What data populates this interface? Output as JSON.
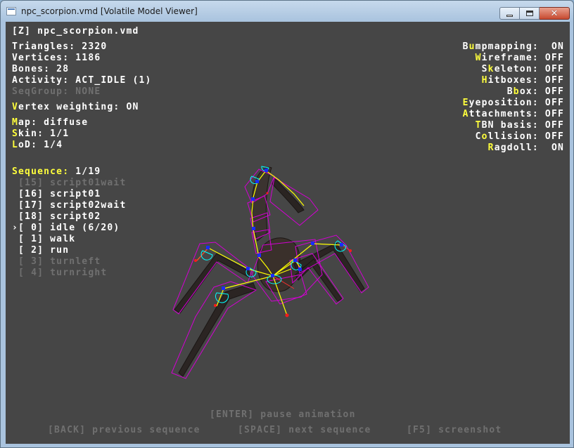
{
  "window": {
    "title": "npc_scorpion.vmd [Volatile Model Viewer]",
    "buttons": {
      "minimize": "minimize-icon",
      "maximize": "maximize-icon",
      "close": "close-icon"
    }
  },
  "hud": {
    "model_index": "[Z]",
    "model_name": "npc_scorpion.vmd",
    "triangles": "Triangles: 2320",
    "vertices": "Vertices: 1186",
    "bones": "Bones: 28",
    "activity": "Activity: ACT_IDLE (1)",
    "seqgroup": "SeqGroup: NONE",
    "vertex_weighting": {
      "key": "V",
      "rest": "ertex weighting: ON"
    },
    "map": {
      "key": "M",
      "rest": "ap: diffuse"
    },
    "skin": {
      "key": "S",
      "rest": "kin: 1/1"
    },
    "lod": {
      "key": "L",
      "rest": "oD: 1/4",
      "pre": ""
    },
    "lod_pre": "",
    "sequence_label": "Sequence:",
    "sequence_value": " 1/19",
    "sequences": [
      {
        "text": " [15] script01wait",
        "state": "dim"
      },
      {
        "text": " [16] script01",
        "state": "normal"
      },
      {
        "text": " [17] script02wait",
        "state": "normal"
      },
      {
        "text": " [18] script02",
        "state": "normal"
      },
      {
        "text": "›[ 0] idle (6/20)",
        "state": "selected"
      },
      {
        "text": " [ 1] walk",
        "state": "normal"
      },
      {
        "text": " [ 2] run",
        "state": "normal"
      },
      {
        "text": " [ 3] turnleft",
        "state": "dim"
      },
      {
        "text": " [ 4] turnright",
        "state": "dim"
      }
    ],
    "toggles": [
      {
        "pre": "B",
        "key": "u",
        "rest": "mpmapping:  ON"
      },
      {
        "pre": "",
        "key": "W",
        "rest": "ireframe: OFF"
      },
      {
        "pre": "S",
        "key": "k",
        "rest": "eleton: OFF"
      },
      {
        "pre": "",
        "key": "H",
        "rest": "itboxes: OFF"
      },
      {
        "pre": "B",
        "key": "b",
        "rest": "ox: OFF"
      },
      {
        "pre": "",
        "key": "E",
        "rest": "yeposition: OFF"
      },
      {
        "pre": "",
        "key": "A",
        "rest": "ttachments: OFF"
      },
      {
        "pre": "",
        "key": "T",
        "rest": "BN basis: OFF"
      },
      {
        "pre": "C",
        "key": "o",
        "rest": "llision: OFF"
      },
      {
        "pre": "",
        "key": "R",
        "rest": "agdoll:  ON"
      }
    ],
    "help": {
      "pause": "[ENTER] pause animation",
      "back": "[BACK] previous sequence",
      "space": "[SPACE] next sequence",
      "f5": "[F5] screenshot"
    }
  },
  "colors": {
    "viewport_bg": "#464646",
    "hud_text": "#ffffff",
    "hud_hotkey": "#ffff3c",
    "hud_dim": "#707070",
    "bbox": "#d400d4",
    "skeleton": "#ffff00",
    "joint": "#0000ff",
    "attachment": "#00ffff",
    "hitbox_point": "#ff0000"
  },
  "icons": {
    "app": "app-window-icon"
  }
}
